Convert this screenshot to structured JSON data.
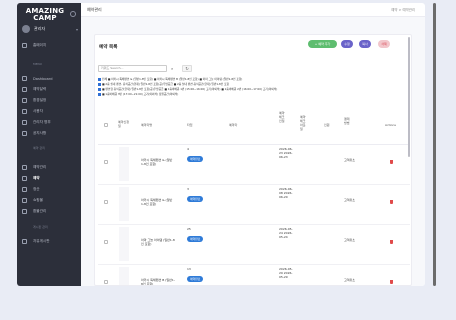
{
  "sidebar": {
    "logo_line1": "AMAZING",
    "logo_line2": "CAMP",
    "profile_name": "관리자",
    "sections": [
      "MENU",
      "예약 관리",
      "게시판 관리"
    ],
    "items": [
      {
        "label": "홈페이지",
        "icon": "home-icon"
      },
      {
        "label": "Dashboard",
        "icon": "dashboard-icon"
      },
      {
        "label": "예약달력",
        "icon": "calendar-icon"
      },
      {
        "label": "환경설정",
        "icon": "settings-icon"
      },
      {
        "label": "사용자",
        "icon": "users-icon"
      },
      {
        "label": "관리자 명부",
        "icon": "admin-icon"
      },
      {
        "label": "공지사항",
        "icon": "notice-icon"
      },
      {
        "label": "예약관리",
        "icon": "reservation-icon"
      },
      {
        "label": "예약",
        "icon": "booking-icon"
      },
      {
        "label": "정산",
        "icon": "settlement-icon"
      },
      {
        "label": "쇼핑몰",
        "icon": "shop-icon"
      },
      {
        "label": "환불관리",
        "icon": "refund-icon"
      },
      {
        "label": "자유게시판",
        "icon": "board-icon"
      }
    ]
  },
  "topbar": {
    "title": "예약관리",
    "breadcrumb": "예약 > 예약관리"
  },
  "card": {
    "title": "예약 목록",
    "buttons": {
      "new": "+ 예약 추가",
      "a": "수정",
      "b": "복사",
      "c": "삭제"
    },
    "search_placeholder": "키워드 Search...",
    "filters": [
      "전체  ■ 아카시 독채펜션 & (일반1-8인 포함)  ■ 아카시 독채펜션 B (일반1-8인 포함)  ■ 아마 그늘 아이템 (일반1-8인 포함)",
      "■ 2층 실내 펜션, 휴식공간(현재) 일반1-8인 포함(공)주방공급  ■ 2층 실내 펜션,휴식공간(현재) 일반1-8인 포함",
      "■ 펜션형 휴식공간(현재) 일반1-8인 포함(공)주방공급  ■ 1층바베큐 1번 (15:00~16:00) 고기(야외석)  ■ 1층바베큐 2번 (16:00~17:00) 고기(야외석)",
      "■ 1층바베큐 3번 (17:00~21:00) 고기(야외석) 정원공간(야외석)"
    ],
    "columns": [
      "예약신청일",
      "예약자명",
      "타입",
      "예약자",
      "예약체크인일",
      "예약체크아웃일",
      "인원",
      "결제방법",
      "Actions"
    ],
    "rows": [
      {
        "product": "아카시 독채펜션 & (일반1-8인 포함)",
        "count": "4",
        "status": "예약완료",
        "checkin": "2026-06-23 2026-06-23",
        "payment": "고객취소"
      },
      {
        "product": "아카시 독채펜션 & (일반1-8인 포함)",
        "count": "3",
        "status": "예약완료",
        "checkin": "2026-06-08 2026-06-20",
        "payment": "고객취소"
      },
      {
        "product": "아마 그늘 아이템 (일반1-8인 포함)",
        "count": "25",
        "status": "예약완료",
        "checkin": "2026-05-24 2026-05-24",
        "payment": "고객취소"
      },
      {
        "product": "아카시 독채펜션 B (일반1-8인 포함)",
        "count": "13",
        "status": "예약완료",
        "checkin": "2026-05-29 2026-05-29",
        "payment": "고객취소"
      }
    ]
  }
}
